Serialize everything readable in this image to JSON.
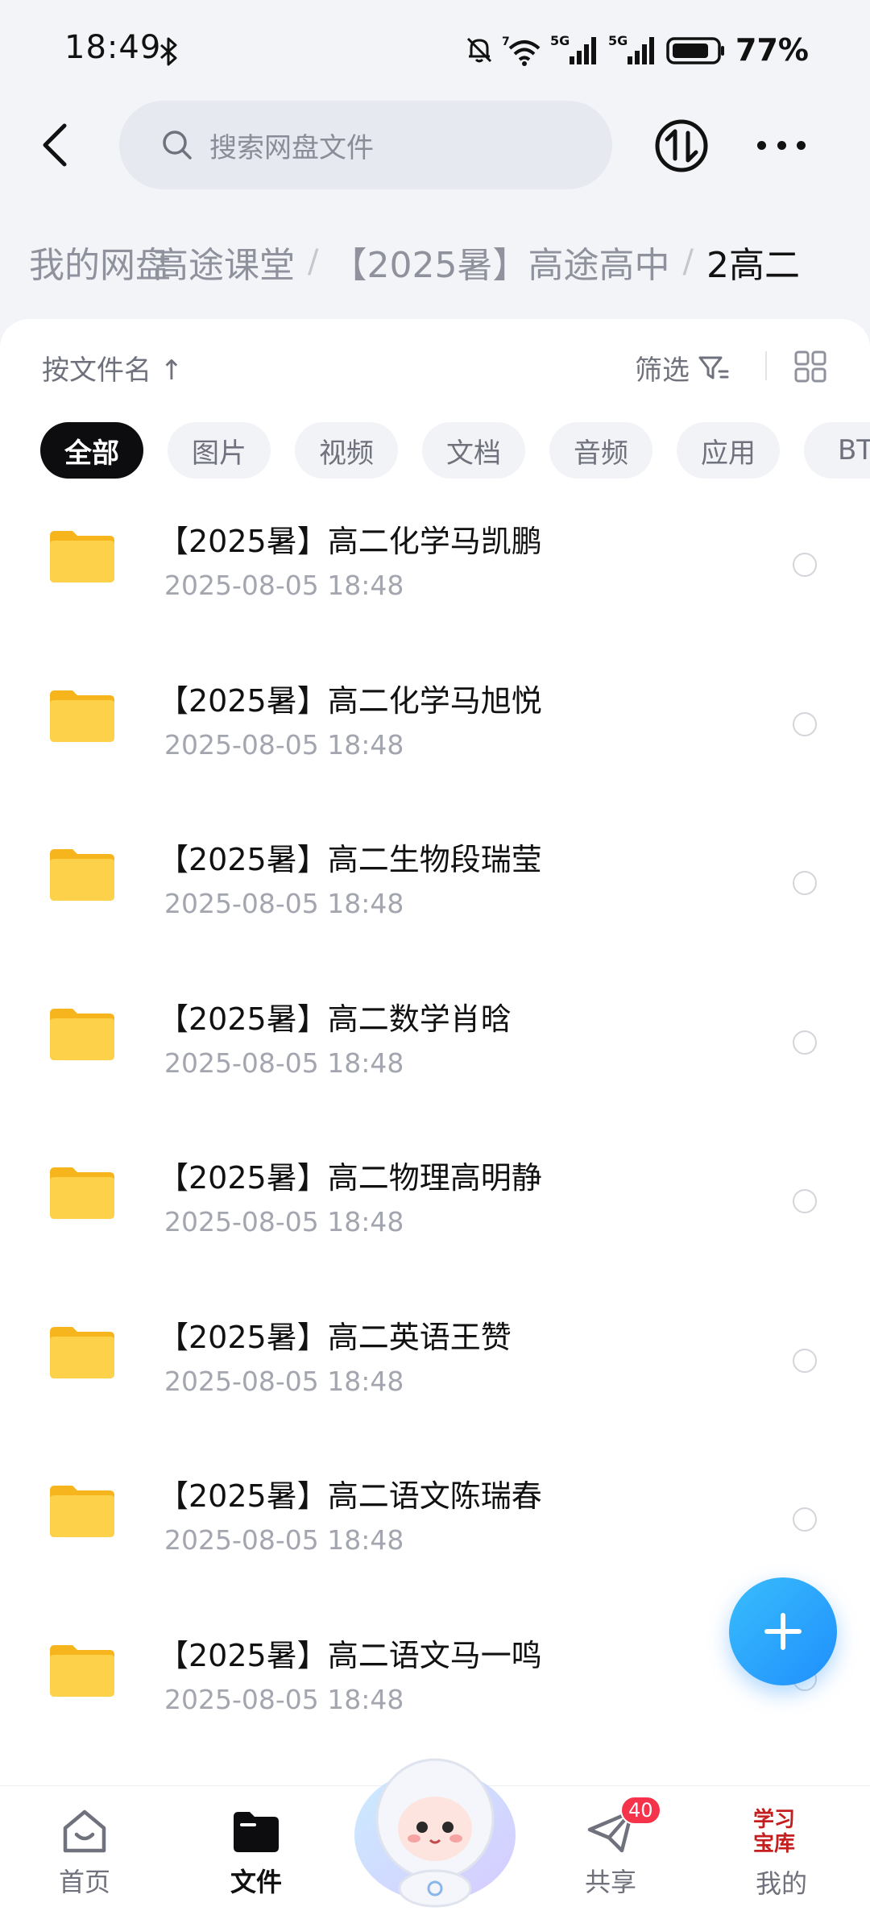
{
  "status_bar": {
    "time": "18:49",
    "battery": "77%",
    "signal_label_1": "5G",
    "signal_label_2": "5G",
    "wifi_label": "7"
  },
  "search": {
    "placeholder": "搜索网盘文件"
  },
  "breadcrumb": {
    "items": [
      "我的网盘",
      "高途课堂",
      "【2025暑】高途高中",
      "2高二"
    ]
  },
  "sort": {
    "label": "按文件名 ↑",
    "filter_label": "筛选"
  },
  "tabs": [
    "全部",
    "图片",
    "视频",
    "文档",
    "音频",
    "应用",
    "BT"
  ],
  "files": [
    {
      "name": "【2025暑】高二化学马凯鹏",
      "date": "2025-08-05  18:48"
    },
    {
      "name": "【2025暑】高二化学马旭悦",
      "date": "2025-08-05  18:48"
    },
    {
      "name": "【2025暑】高二生物段瑞莹",
      "date": "2025-08-05  18:48"
    },
    {
      "name": "【2025暑】高二数学肖晗",
      "date": "2025-08-05  18:48"
    },
    {
      "name": "【2025暑】高二物理高明静",
      "date": "2025-08-05  18:48"
    },
    {
      "name": "【2025暑】高二英语王赞",
      "date": "2025-08-05  18:48"
    },
    {
      "name": "【2025暑】高二语文陈瑞春",
      "date": "2025-08-05  18:48"
    },
    {
      "name": "【2025暑】高二语文马一鸣",
      "date": "2025-08-05  18:48"
    }
  ],
  "bottom_nav": {
    "home": "首页",
    "files": "文件",
    "share": "共享",
    "share_badge": "40",
    "mine": "我的",
    "mine_logo_text": "学习宝库"
  },
  "colors": {
    "accent": "#1f8ffd",
    "badge": "#f5334a",
    "folder": "#fcc93a"
  },
  "icons": [
    "back-arrow-icon",
    "search-icon",
    "transfer-icon",
    "more-icon",
    "sort-arrow-icon",
    "filter-icon",
    "grid-view-icon",
    "folder-icon",
    "plus-icon",
    "home-icon",
    "files-icon",
    "share-icon"
  ]
}
